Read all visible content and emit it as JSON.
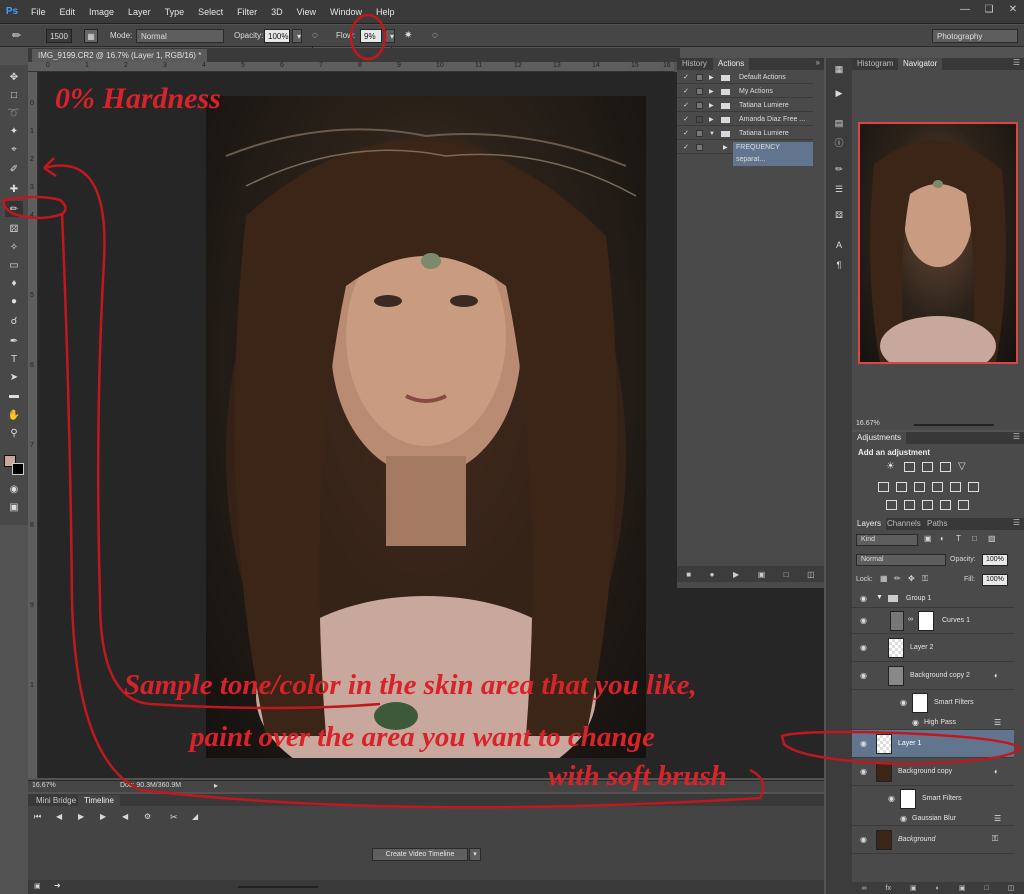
{
  "app": {
    "logo": "Ps"
  },
  "menu": [
    "File",
    "Edit",
    "Image",
    "Layer",
    "Type",
    "Select",
    "Filter",
    "3D",
    "View",
    "Window",
    "Help"
  ],
  "options": {
    "brush_size": "1500",
    "mode_label": "Mode:",
    "mode_value": "Normal",
    "opacity_label": "Opacity:",
    "opacity_value": "100%",
    "flow_label": "Flow:",
    "flow_value": "9%",
    "workspace": "Photography"
  },
  "document": {
    "tab_title": "IMG_9199.CR2 @ 16.7% (Layer 1, RGB/16) *",
    "ruler_top": [
      "0",
      "1",
      "2",
      "3",
      "4",
      "5",
      "6",
      "7",
      "8",
      "9",
      "10",
      "11",
      "12",
      "13",
      "14",
      "15",
      "16"
    ],
    "ruler_left": [
      "0",
      "1",
      "2",
      "3",
      "4",
      "5",
      "6",
      "7",
      "8",
      "9",
      "1"
    ],
    "zoom": "16.67%",
    "doc_size": "Doc: 90.3M/360.9M"
  },
  "timeline": {
    "tabs": [
      "Mini Bridge",
      "Timeline"
    ],
    "create_button": "Create Video Timeline"
  },
  "actions_panel": {
    "tabs": [
      "History",
      "Actions"
    ],
    "items": [
      {
        "name": "Default Actions",
        "checked": true,
        "expanded": false
      },
      {
        "name": "My Actions",
        "checked": true,
        "expanded": false
      },
      {
        "name": "Tatiana Lumiere",
        "checked": true,
        "expanded": false
      },
      {
        "name": "Amanda Diaz Free ...",
        "checked": true,
        "expanded": false
      },
      {
        "name": "Tatiana Lumiere",
        "checked": true,
        "expanded": true
      },
      {
        "name": "FREQUENCY separat...",
        "checked": true,
        "expanded": false,
        "selected": true
      }
    ]
  },
  "navigator": {
    "tabs": [
      "Histogram",
      "Navigator"
    ],
    "zoom": "16.67%"
  },
  "adjustments": {
    "tab": "Adjustments",
    "title": "Add an adjustment"
  },
  "layers": {
    "tabs": [
      "Layers",
      "Channels",
      "Paths"
    ],
    "kind_label": "Kind",
    "blend_mode": "Normal",
    "opacity_label": "Opacity:",
    "opacity_value": "100%",
    "lock_label": "Lock:",
    "fill_label": "Fill:",
    "fill_value": "100%",
    "items": [
      {
        "name": "Group 1"
      },
      {
        "name": "Curves 1"
      },
      {
        "name": "Layer 2"
      },
      {
        "name": "Background copy 2"
      },
      {
        "name": "Smart Filters"
      },
      {
        "name": "High Pass"
      },
      {
        "name": "Layer 1",
        "selected": true
      },
      {
        "name": "Background copy"
      },
      {
        "name": "Smart Filters"
      },
      {
        "name": "Gaussian Blur"
      },
      {
        "name": "Background"
      }
    ]
  },
  "annotations": {
    "hardness": "0% Hardness",
    "line1": "Sample tone/color in the skin area that you like,",
    "line2": "paint over the area you want to change",
    "line3": "with soft brush"
  },
  "colors": {
    "annotation_red": "#d8232a",
    "selection_blue": "#62758f",
    "canvas_bg": "#262626"
  }
}
